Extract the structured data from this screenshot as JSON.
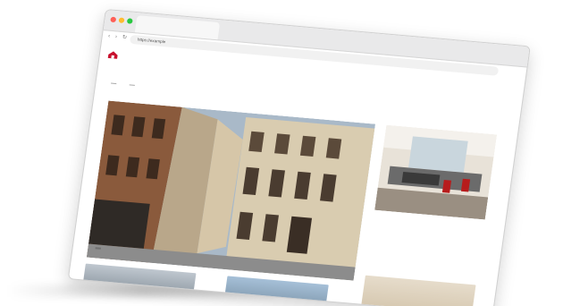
{
  "browser": {
    "tab_label": "",
    "url": "https://example"
  },
  "site": {
    "brand": "",
    "menu": [
      "",
      "",
      "",
      "",
      "",
      "",
      ""
    ]
  },
  "filters": {
    "items": [
      "",
      ""
    ],
    "sort": ""
  },
  "breadcrumb": "",
  "hero": {
    "caption": ""
  },
  "listing": {
    "title": "",
    "subtitle": "",
    "meta1": "",
    "meta2": ""
  }
}
